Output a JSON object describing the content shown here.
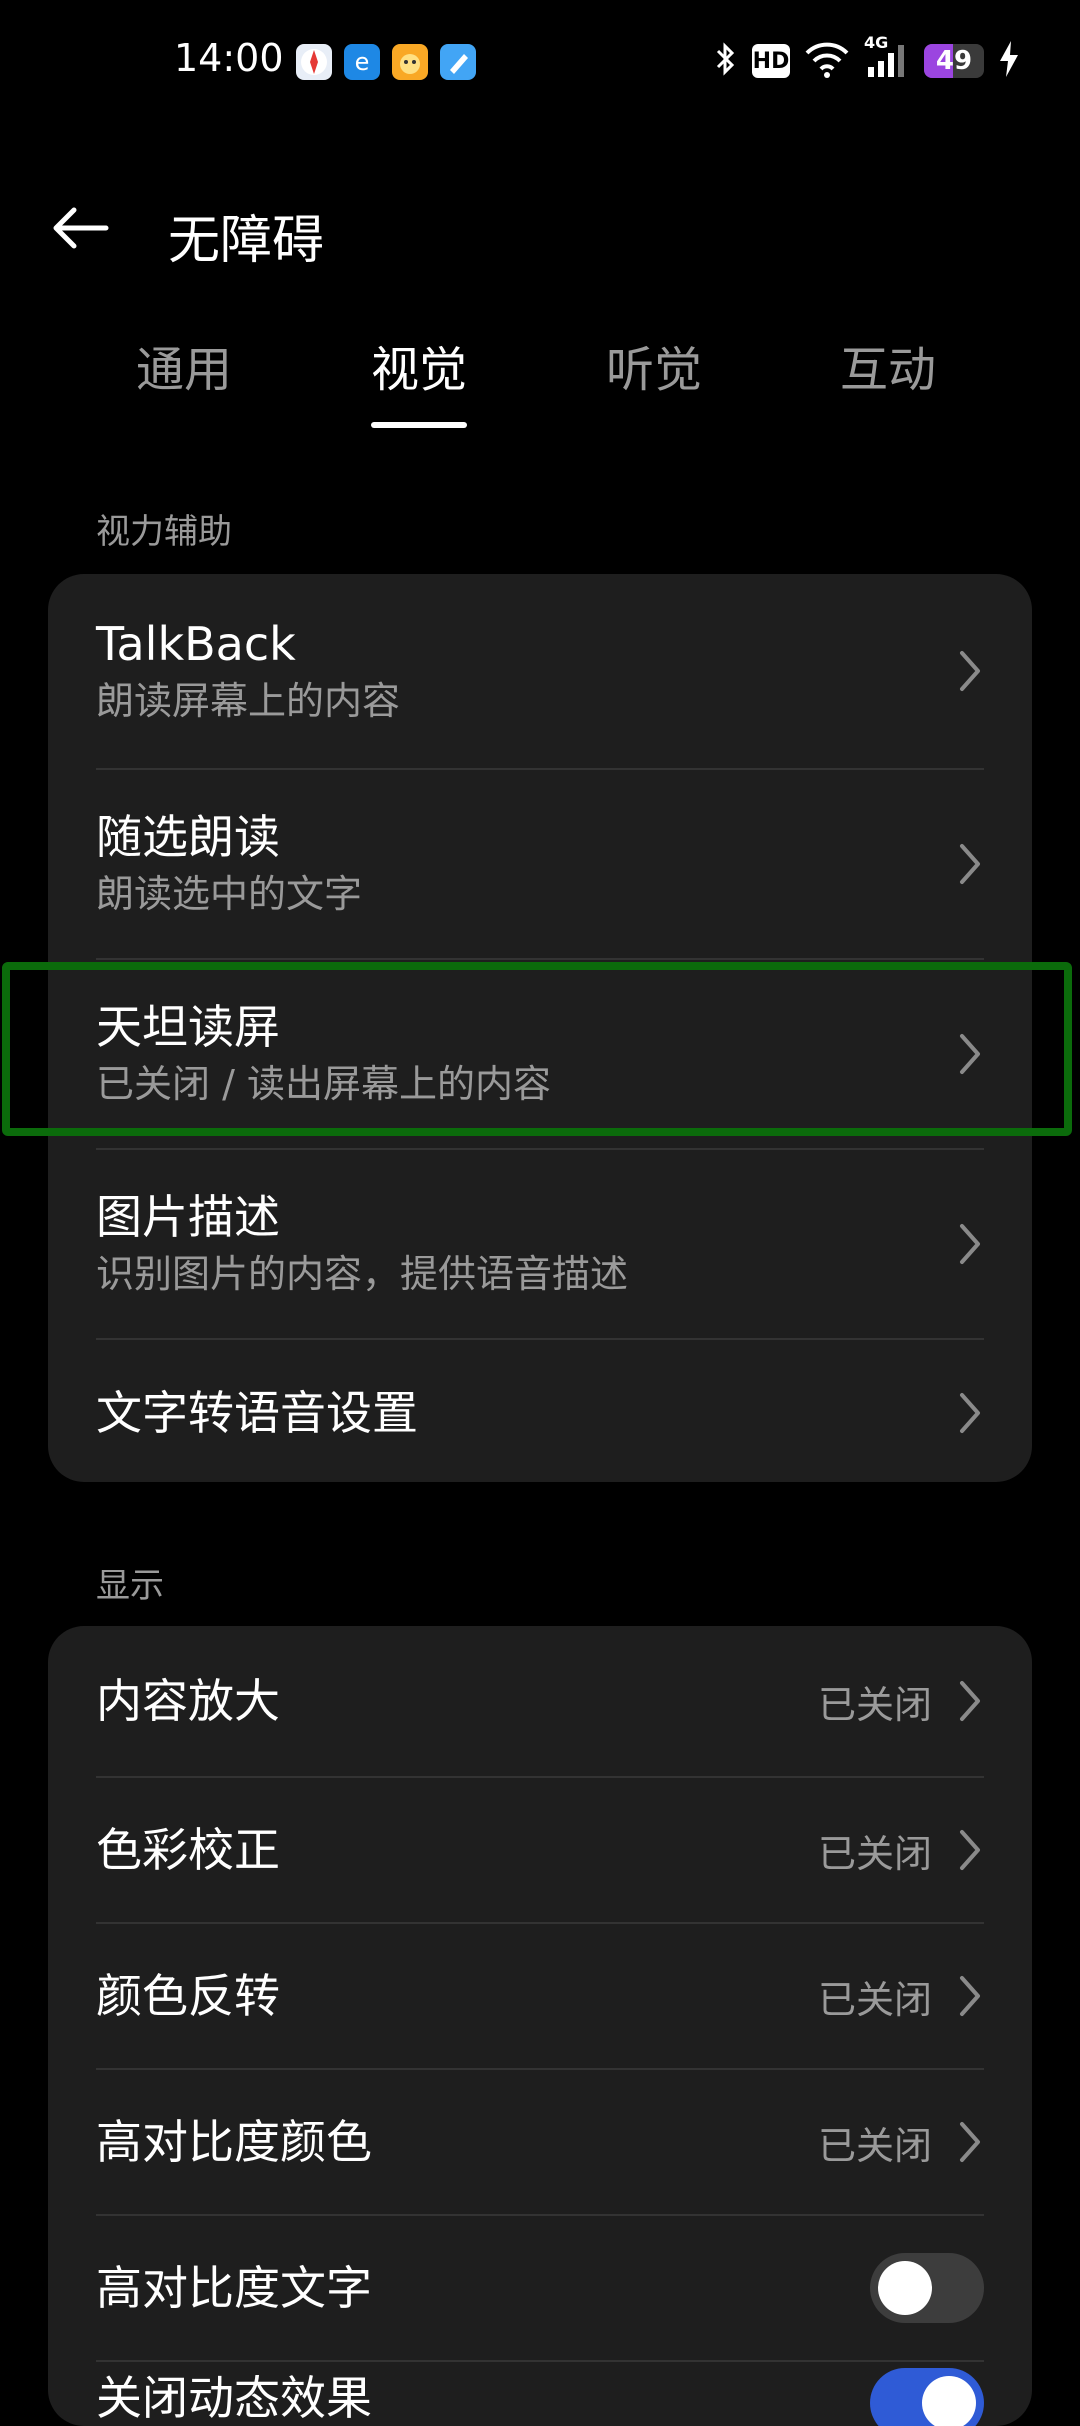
{
  "status_bar": {
    "time": "14:00",
    "hd": "HD",
    "network": "4G",
    "battery": "49",
    "battery_level": 0.49,
    "colors": {
      "battery_fill": "#9b45e0"
    }
  },
  "header": {
    "title": "无障碍",
    "back_icon": "arrow-left-icon"
  },
  "tabs": {
    "items": [
      {
        "label": "通用"
      },
      {
        "label": "视觉"
      },
      {
        "label": "听觉"
      },
      {
        "label": "互动"
      }
    ],
    "active_index": 1
  },
  "sections": {
    "vision": {
      "label": "视力辅助",
      "items": [
        {
          "title": "TalkBack",
          "subtitle": "朗读屏幕上的内容"
        },
        {
          "title": "随选朗读",
          "subtitle": "朗读选中的文字"
        },
        {
          "title": "天坦读屏",
          "subtitle": "已关闭 / 读出屏幕上的内容"
        },
        {
          "title": "图片描述",
          "subtitle": "识别图片的内容，提供语音描述"
        },
        {
          "title": "文字转语音设置"
        }
      ]
    },
    "display": {
      "label": "显示",
      "items": [
        {
          "title": "内容放大",
          "value": "已关闭"
        },
        {
          "title": "色彩校正",
          "value": "已关闭"
        },
        {
          "title": "颜色反转",
          "value": "已关闭"
        },
        {
          "title": "高对比度颜色",
          "value": "已关闭"
        },
        {
          "title": "高对比度文字",
          "toggle": false
        },
        {
          "title": "关闭动态效果",
          "toggle": true
        }
      ]
    }
  },
  "colors": {
    "background": "#000000",
    "card": "#1e1e1e",
    "secondary_text": "#9a9a9a",
    "highlight": "#0b6b0b",
    "toggle_on": "#2f5bd6"
  }
}
